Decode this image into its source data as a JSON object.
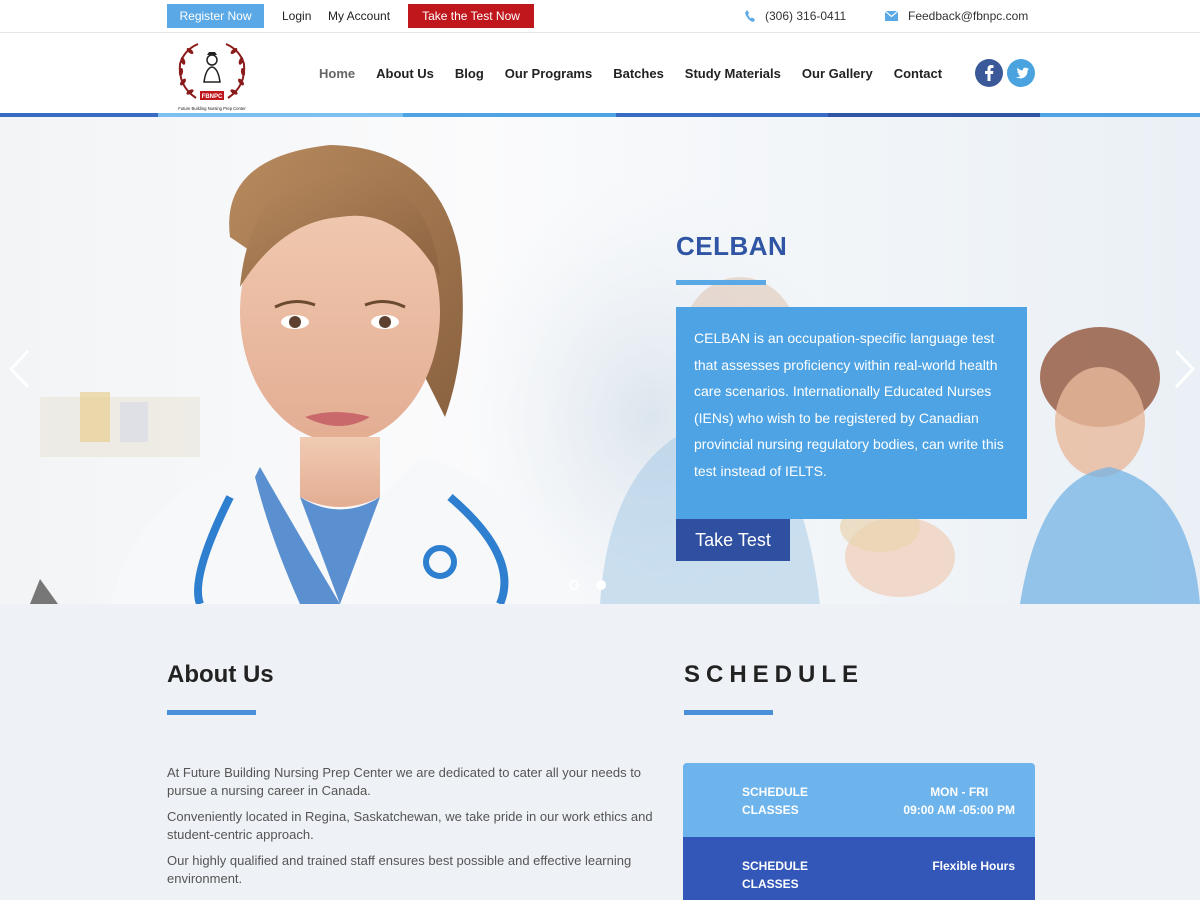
{
  "topbar": {
    "register": "Register Now",
    "login": "Login",
    "account": "My Account",
    "take_test": "Take the Test Now",
    "phone": "(306) 316-0411",
    "email": "Feedback@fbnpc.com"
  },
  "logo": {
    "badge": "FBNPC",
    "caption": "Future Building Nursing Prep Center"
  },
  "nav": {
    "items": [
      "Home",
      "About Us",
      "Blog",
      "Our Programs",
      "Batches",
      "Study Materials",
      "Our Gallery",
      "Contact"
    ],
    "active": "Home"
  },
  "social": {
    "facebook": "facebook-icon",
    "twitter": "twitter-icon"
  },
  "hero": {
    "title": "CELBAN",
    "description": "CELBAN is an occupation-specific language test that assesses proficiency within real-world health care scenarios. Internationally Educated Nurses (IENs) who wish to be registered by Canadian provincial nursing regulatory bodies, can write this test instead of IELTS.",
    "button": "Take Test",
    "slides": 2,
    "active_slide": 1
  },
  "about": {
    "title": "About Us",
    "paragraphs": [
      "At Future Building Nursing Prep Center we are dedicated to cater all your needs to pursue a nursing career in Canada.",
      "Conveniently located in Regina, Saskatchewan, we take pride in our work ethics and student-centric approach.",
      "Our highly qualified and trained staff ensures best possible and effective learning environment."
    ]
  },
  "schedule": {
    "title": "SCHEDULE",
    "rows": [
      {
        "label_1": "SCHEDULE",
        "label_2": "CLASSES",
        "time_1": "MON - FRI",
        "time_2": "09:00 AM -05:00 PM"
      },
      {
        "label_1": "SCHEDULE",
        "label_2": "CLASSES",
        "time_1": "Flexible Hours",
        "time_2": ""
      }
    ]
  },
  "colors": {
    "primary_blue": "#2f55a4",
    "light_blue": "#4da3e4",
    "register_blue": "#5aa9e6",
    "test_red": "#c0171c",
    "schedule_light": "#6eb4ec",
    "schedule_dark": "#3357b8"
  }
}
